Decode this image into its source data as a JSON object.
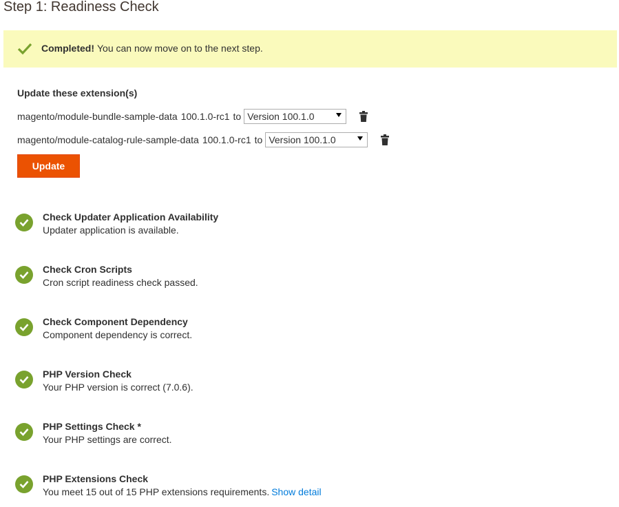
{
  "page": {
    "title": "Step 1: Readiness Check"
  },
  "banner": {
    "icon": "check-icon",
    "strong": "Completed!",
    "text": "You can now move on to the next step.",
    "background": "#fafabc",
    "check_color": "#79a22e"
  },
  "extensions": {
    "heading": "Update these extension(s)",
    "items": [
      {
        "name": "magento/module-bundle-sample-data",
        "current_version": "100.1.0-rc1",
        "to_label": "to",
        "selected_version": "Version 100.1.0",
        "delete_icon": "trash-icon"
      },
      {
        "name": "magento/module-catalog-rule-sample-data",
        "current_version": "100.1.0-rc1",
        "to_label": "to",
        "selected_version": "Version 100.1.0",
        "delete_icon": "trash-icon"
      }
    ],
    "update_label": "Update",
    "update_color": "#eb5202"
  },
  "checks": [
    {
      "title": "Check Updater Application Availability",
      "description": "Updater application is available.",
      "status": "success"
    },
    {
      "title": "Check Cron Scripts",
      "description": "Cron script readiness check passed.",
      "status": "success"
    },
    {
      "title": "Check Component Dependency",
      "description": "Component dependency is correct.",
      "status": "success"
    },
    {
      "title": "PHP Version Check",
      "description": "Your PHP version is correct (7.0.6).",
      "status": "success"
    },
    {
      "title": "PHP Settings Check *",
      "description": "Your PHP settings are correct.",
      "status": "success"
    },
    {
      "title": "PHP Extensions Check",
      "description": "You meet 15 out of 15 PHP extensions requirements.",
      "link": "Show detail",
      "status": "success"
    }
  ]
}
